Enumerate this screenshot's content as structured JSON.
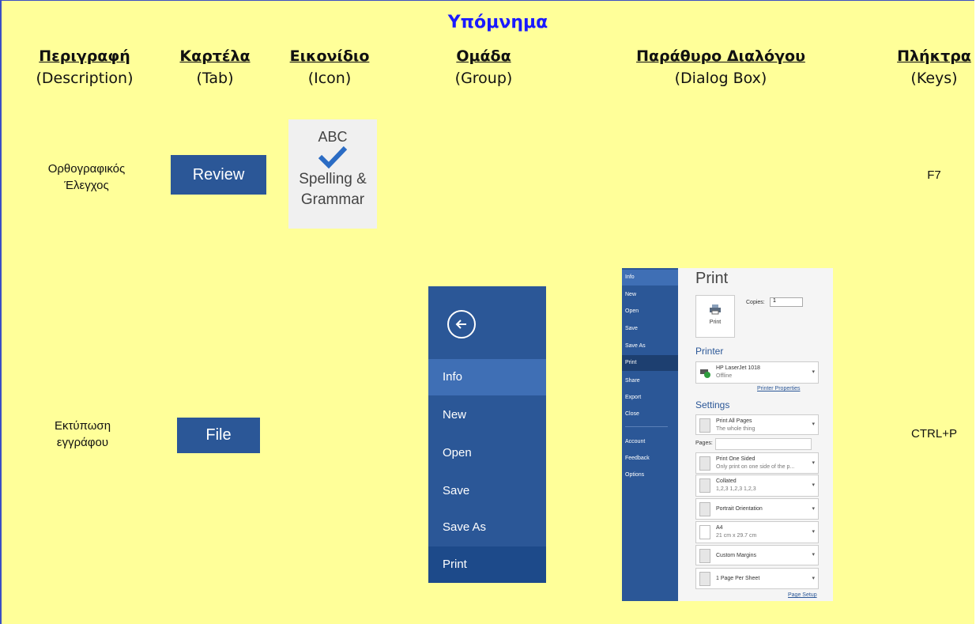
{
  "title": "Υπόμνημα",
  "headers": [
    {
      "gr": "Περιγραφή",
      "en": "(Description)"
    },
    {
      "gr": "Καρτέλα",
      "en": "(Tab)"
    },
    {
      "gr": "Εικονίδιο",
      "en": "(Icon)"
    },
    {
      "gr": "Ομάδα",
      "en": "(Group)"
    },
    {
      "gr": "Παράθυρο Διαλόγου",
      "en": "(Dialog Box)"
    },
    {
      "gr": "Πλήκτρα",
      "en": "(Keys)"
    }
  ],
  "rows": [
    {
      "description_line1": "Ορθογραφικός",
      "description_line2": "Έλεγχος",
      "tab": "Review",
      "keys": "F7",
      "icon": {
        "name": "spelling-check-icon",
        "abc": "ABC",
        "label_line1": "Spelling &",
        "label_line2": "Grammar"
      }
    },
    {
      "description_line1": "Εκτύπωση",
      "description_line2": "εγγράφου",
      "tab": "File",
      "keys": "CTRL+P"
    }
  ],
  "group_menu": {
    "items": [
      "Info",
      "New",
      "Open",
      "Save",
      "Save As",
      "Print"
    ],
    "selected": "Info"
  },
  "dialog": {
    "side_items": [
      "Info",
      "New",
      "Open",
      "Save",
      "Save As",
      "Print",
      "Share",
      "Export",
      "Close",
      "Account",
      "Feedback",
      "Options"
    ],
    "title": "Print",
    "print_button": "Print",
    "copies_label": "Copies:",
    "copies_value": "1",
    "printer_section": "Printer",
    "printer_name": "HP LaserJet 1018",
    "printer_status": "Offline",
    "printer_properties": "Printer Properties",
    "settings_section": "Settings",
    "pages_label": "Pages:",
    "settings": [
      {
        "t1": "Print All Pages",
        "t2": "The whole thing"
      },
      {
        "t1": "Print One Sided",
        "t2": "Only print on one side of the p..."
      },
      {
        "t1": "Collated",
        "t2": "1,2,3   1,2,3   1,2,3"
      },
      {
        "t1": "Portrait Orientation",
        "t2": ""
      },
      {
        "t1": "A4",
        "t2": "21 cm x 29.7 cm"
      },
      {
        "t1": "Custom Margins",
        "t2": ""
      },
      {
        "t1": "1 Page Per Sheet",
        "t2": ""
      }
    ],
    "page_setup": "Page Setup"
  },
  "colors": {
    "background": "#ffff99",
    "title": "#1a1aff",
    "office_blue": "#2b5797"
  }
}
